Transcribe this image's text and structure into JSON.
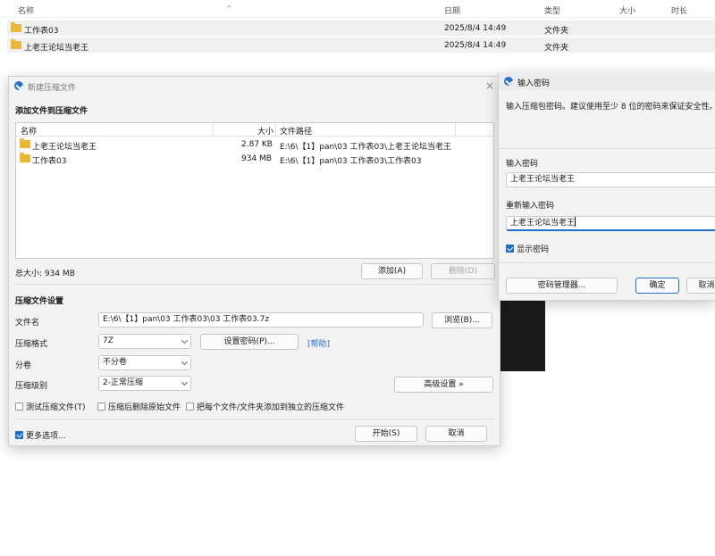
{
  "explorer": {
    "columns": {
      "name": "名称",
      "date": "日期",
      "type": "类型",
      "size": "大小",
      "duration": "时长"
    },
    "rows": [
      {
        "name": "工作表03",
        "date": "2025/8/4 14:49",
        "type": "文件夹"
      },
      {
        "name": "上老王论坛当老王",
        "date": "2025/8/4 14:49",
        "type": "文件夹"
      }
    ]
  },
  "main_dialog": {
    "title": "新建压缩文件",
    "close_glyph": "×",
    "add_section": "添加文件到压缩文件",
    "file_list": {
      "headers": {
        "name": "名称",
        "size": "大小",
        "path": "文件路径"
      },
      "rows": [
        {
          "name": "上老王论坛当老王",
          "size": "2.87 KB",
          "path": "E:\\6\\【1】pan\\03 工作表03\\上老王论坛当老王"
        },
        {
          "name": "工作表03",
          "size": "934 MB",
          "path": "E:\\6\\【1】pan\\03 工作表03\\工作表03"
        }
      ]
    },
    "total_size": "总大小: 934 MB",
    "add_button": "添加(A)",
    "delete_button": "删除(D)",
    "settings_section": "压缩文件设置",
    "filename_label": "文件名",
    "filename_value": "E:\\6\\【1】pan\\03 工作表03\\03 工作表03.7z",
    "browse_button": "浏览(B)...",
    "format_label": "压缩格式",
    "format_value": "7Z",
    "set_password_button": "设置密码(P)...",
    "help_link": "[帮助]",
    "split_label": "分卷",
    "split_value": "不分卷",
    "level_label": "压缩级别",
    "level_value": "2-正常压缩",
    "advanced_button": "高级设置 »",
    "check_test": "测试压缩文件(T)",
    "check_delete": "压缩后删除原始文件",
    "check_separate": "把每个文件/文件夹添加到独立的压缩文件",
    "more_options": "更多选项...",
    "start_button": "开始(S)",
    "cancel_button": "取消"
  },
  "password_dialog": {
    "title": "输入密码",
    "description": "输入压缩包密码。建议使用至少 8 位的密码来保证安全性。",
    "enter_label": "输入密码",
    "enter_value": "上老王论坛当老王",
    "reenter_label": "重新输入密码",
    "reenter_value": "上老王论坛当老王",
    "show_password": "显示密码",
    "manager_button": "密码管理器...",
    "ok_button": "确定",
    "cancel_button": "取消"
  },
  "colors": {
    "accent": "#1f6fc9",
    "folder": "#e8b73c",
    "dialog_bg": "#f3f3f3"
  }
}
